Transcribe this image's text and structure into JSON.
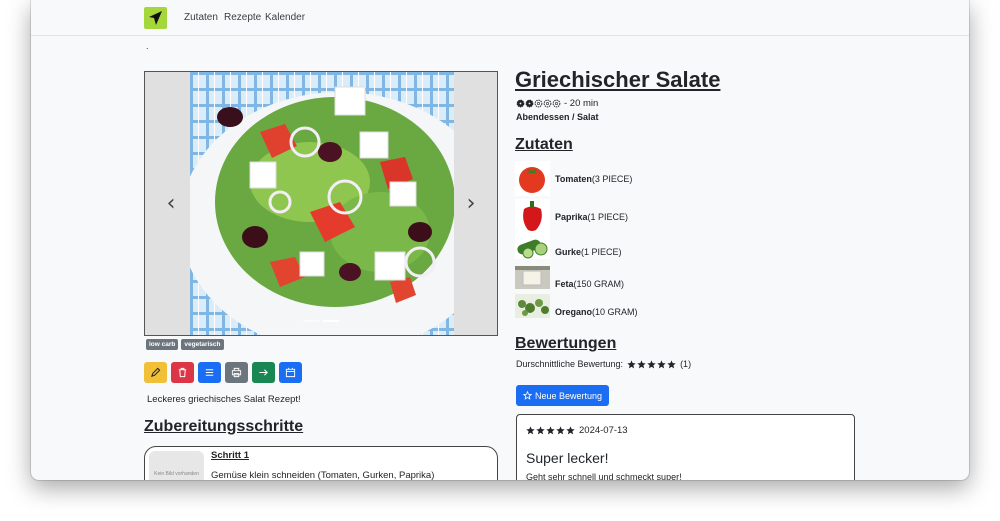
{
  "nav": {
    "links": [
      "Zutaten",
      "Rezepte",
      "Kalender"
    ],
    "dot": "."
  },
  "recipe": {
    "title": "Griechischer Salate",
    "duration": "- 20 min",
    "difficulty_level": 2,
    "difficulty_max": 5,
    "category": "Abendessen / Salat",
    "tags": [
      "low carb",
      "vegetarisch"
    ],
    "description": "Leckeres griechisches Salat Rezept!",
    "carousel": {
      "active_index": 1,
      "slide_count": 2
    }
  },
  "actions": [
    {
      "name": "edit-button",
      "icon": "pencil-icon",
      "color": "#f2c038"
    },
    {
      "name": "delete-button",
      "icon": "trash-icon",
      "color": "#dc3545"
    },
    {
      "name": "list-button",
      "icon": "list-icon",
      "color": "#1b6ef3"
    },
    {
      "name": "print-button",
      "icon": "printer-icon",
      "color": "#6c757d"
    },
    {
      "name": "forward-button",
      "icon": "arrow-right-icon",
      "color": "#198754"
    },
    {
      "name": "calendar-button",
      "icon": "calendar-icon",
      "color": "#1b6ef3"
    }
  ],
  "ingredients_heading": "Zutaten",
  "ingredients": [
    {
      "name": "Tomaten",
      "amount": "(3 PIECE)",
      "icon": "tomato-image"
    },
    {
      "name": "Paprika",
      "amount": "(1 PIECE)",
      "icon": "pepper-image"
    },
    {
      "name": "Gurke",
      "amount": "(1 PIECE)",
      "icon": "cucumber-image"
    },
    {
      "name": "Feta",
      "amount": "(150 GRAM)",
      "icon": "feta-image"
    },
    {
      "name": "Oregano",
      "amount": "(10 GRAM)",
      "icon": "oregano-image"
    }
  ],
  "reviews": {
    "heading": "Bewertungen",
    "average_label": "Durschnittliche Bewertung:",
    "average_stars": 5,
    "count": "(1)",
    "new_button": "Neue Bewertung",
    "items": [
      {
        "stars": 5,
        "date": "2024-07-13",
        "title": "Super lecker!",
        "text": "Geht sehr schnell und schmeckt super!"
      }
    ]
  },
  "steps": {
    "heading": "Zubereitungsschritte",
    "no_image": "Kein Bild vorhanden",
    "items": [
      {
        "title": "Schritt 1",
        "text": "Gemüse klein schneiden (Tomaten, Gurken, Paprika)"
      }
    ]
  },
  "colors": {
    "accent": "#1b6ef3",
    "logo": "#a6d73a",
    "tag": "#6c757d"
  }
}
